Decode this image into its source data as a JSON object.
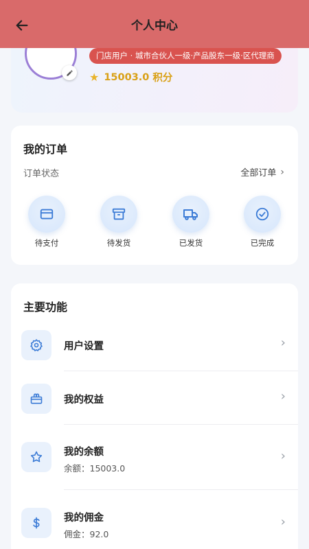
{
  "header": {
    "title": "个人中心"
  },
  "profile": {
    "role_badge": "门店用户 · 城市合伙人一级·产品股东一级·区代理商",
    "points_value": "15003.0",
    "points_unit": "积分"
  },
  "orders": {
    "title": "我的订单",
    "status_label": "订单状态",
    "all_label": "全部订单",
    "items": [
      {
        "label": "待支付",
        "icon": "card-icon"
      },
      {
        "label": "待发货",
        "icon": "box-icon"
      },
      {
        "label": "已发货",
        "icon": "truck-icon"
      },
      {
        "label": "已完成",
        "icon": "check-circle-icon"
      }
    ]
  },
  "functions": {
    "title": "主要功能",
    "items": [
      {
        "name": "用户设置",
        "icon": "gear-icon"
      },
      {
        "name": "我的权益",
        "icon": "gift-icon"
      },
      {
        "name": "我的余额",
        "sub": "余额：15003.0",
        "icon": "star-icon"
      },
      {
        "name": "我的佣金",
        "sub": "佣金：92.0",
        "icon": "dollar-icon"
      }
    ]
  },
  "colors": {
    "header": "#d96a6a",
    "badge": "#d9534f",
    "points": "#d9a016",
    "icon_blue": "#3b7bd6"
  }
}
